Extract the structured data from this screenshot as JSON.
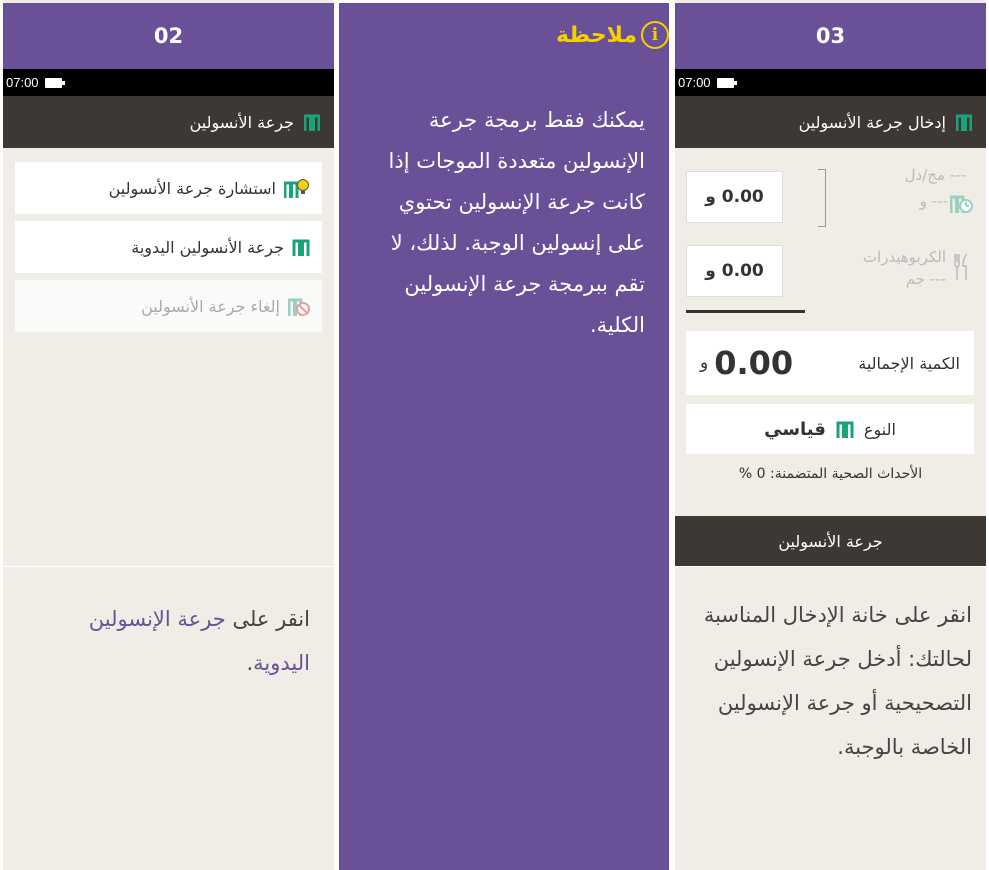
{
  "left": {
    "step": "02",
    "status_time": "07:00",
    "screen_title": "جرعة الأنسولين",
    "menu": [
      {
        "label": "استشارة جرعة الأنسولين",
        "icon": "bolus-advisor-icon",
        "enabled": true
      },
      {
        "label": "جرعة الأنسولين اليدوية",
        "icon": "manual-bolus-icon",
        "enabled": true
      },
      {
        "label": "إلغاء جرعة الأنسولين",
        "icon": "cancel-bolus-icon",
        "enabled": false
      }
    ],
    "caption_prefix": "انقر على ",
    "caption_highlight": "جرعة الإنسولين اليدوية",
    "caption_suffix": "."
  },
  "note": {
    "title": "ملاحظة",
    "icon": "info-icon",
    "text": "يمكنك فقط برمجة جرعة الإنسولين متعددة الموجات إذا كانت جرعة الإنسولين تحتوي على إنسولين الوجبة. لذلك، لا تقم ببرمجة جرعة الإنسولين الكلية."
  },
  "right": {
    "step": "03",
    "status_time": "07:00",
    "screen_title": "إدخال جرعة الأنسولين",
    "bg_value_placeholder": "--- مج/دل",
    "bg_units_placeholder": "--- و",
    "correction_input": "0.00 و",
    "carbs_label": "الكربوهيدرات",
    "carbs_placeholder": "--- جم",
    "meal_input": "0.00 و",
    "total_label": "الكمية الإجمالية",
    "total_value": "0.00",
    "total_unit": "و",
    "type_label": "النوع",
    "type_value": "قياسي",
    "health_events": "الأحداث الصحية المتضمنة: 0 %",
    "confirm_button": "جرعة الأنسولين",
    "caption": "انقر على خانة الإدخال المناسبة لحالتك: أدخل جرعة الإنسولين التصحيحية أو جرعة الإنسولين الخاصة بالوجبة."
  },
  "colors": {
    "purple": "#6a5096",
    "yellow": "#f7d000",
    "insulin_green": "#1aa37a",
    "dark_bar": "#3e3835",
    "screen_bg": "#f0ede7"
  }
}
